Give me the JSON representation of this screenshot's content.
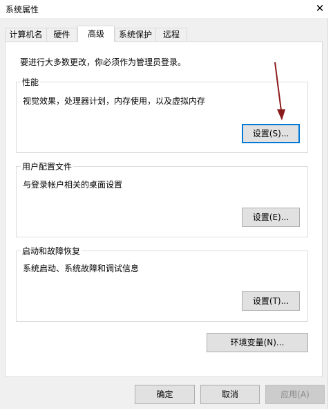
{
  "window": {
    "title": "系统属性",
    "close_glyph": "✕"
  },
  "tabs": [
    {
      "label": "计算机名",
      "active": false
    },
    {
      "label": "硬件",
      "active": false
    },
    {
      "label": "高级",
      "active": true
    },
    {
      "label": "系统保护",
      "active": false
    },
    {
      "label": "远程",
      "active": false
    }
  ],
  "advanced": {
    "intro": "要进行大多数更改，你必须作为管理员登录。",
    "performance": {
      "title": "性能",
      "description": "视觉效果，处理器计划，内存使用，以及虚拟内存",
      "button": "设置(S)..."
    },
    "user_profiles": {
      "title": "用户配置文件",
      "description": "与登录帐户相关的桌面设置",
      "button": "设置(E)..."
    },
    "startup_recovery": {
      "title": "启动和故障恢复",
      "description": "系统启动、系统故障和调试信息",
      "button": "设置(T)..."
    },
    "env_button": "环境变量(N)..."
  },
  "footer": {
    "ok": "确定",
    "cancel": "取消",
    "apply": "应用(A)"
  },
  "colors": {
    "annotation_arrow": "#8b1a1a",
    "focus_border": "#0078d7"
  }
}
